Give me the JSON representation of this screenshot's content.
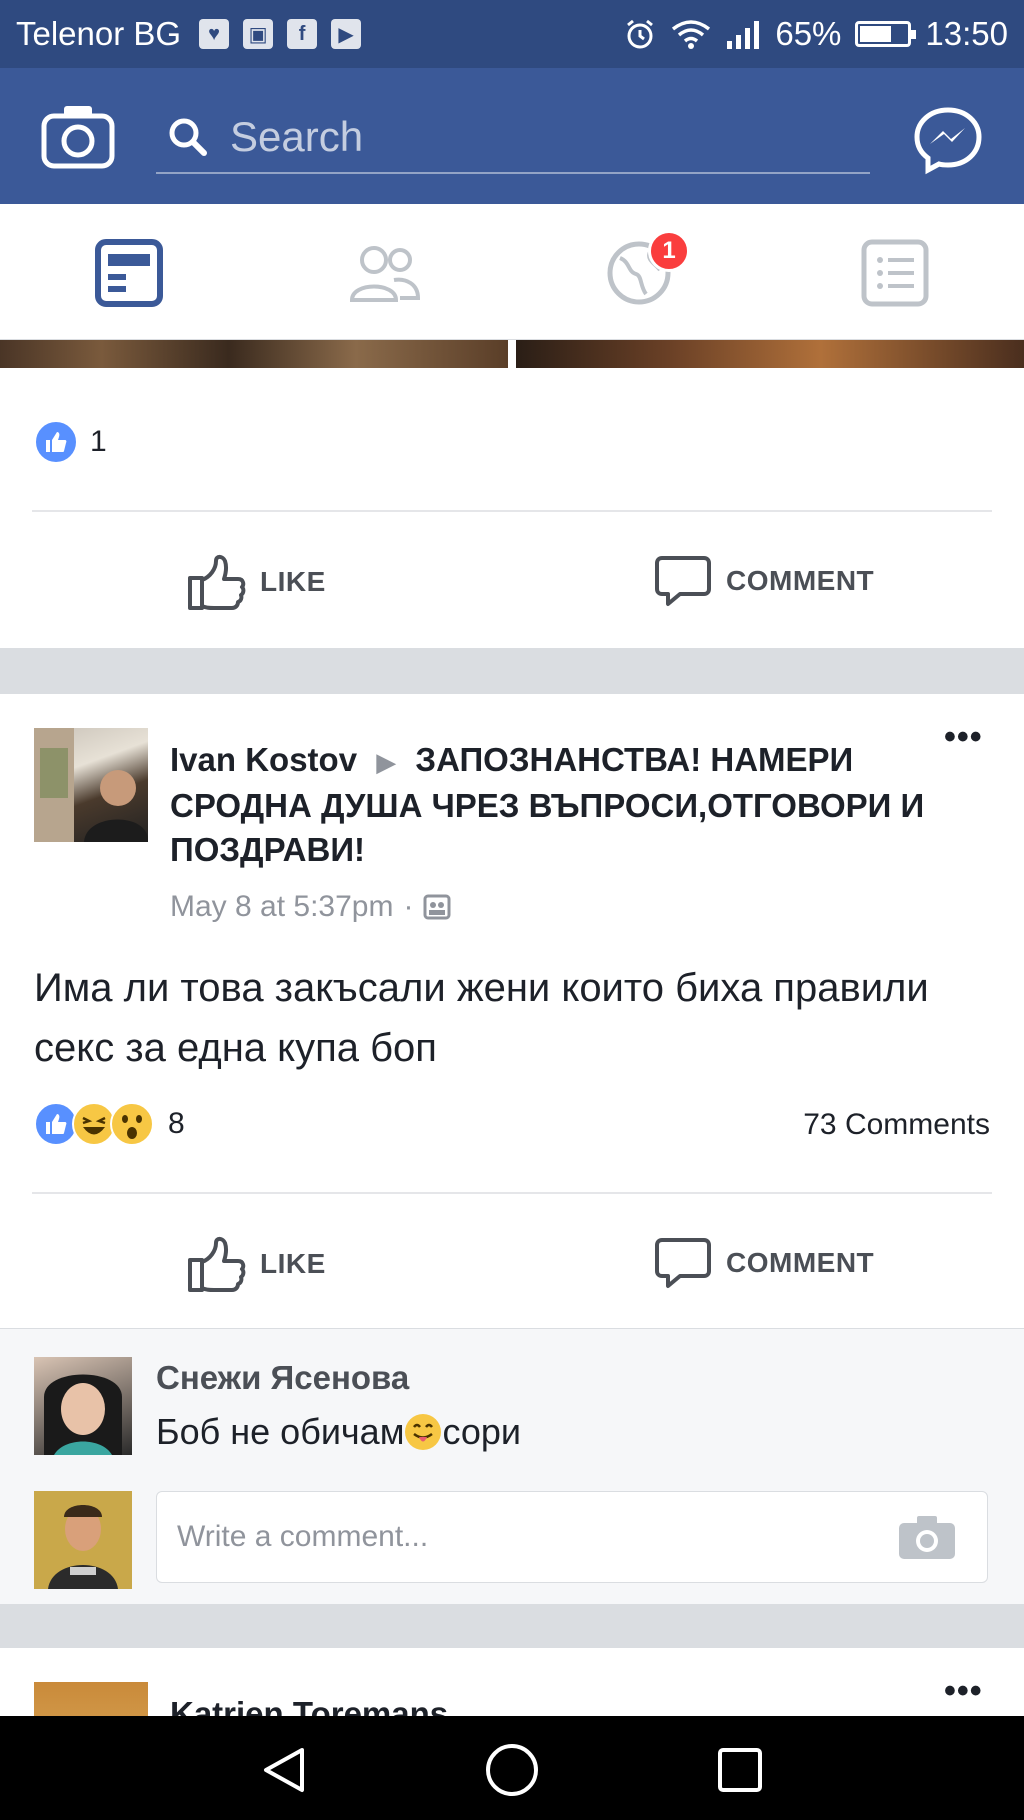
{
  "status_bar": {
    "carrier": "Telenor BG",
    "battery": "65%",
    "time": "13:50"
  },
  "top_bar": {
    "search_placeholder": "Search"
  },
  "notifications": {
    "badge_count": "1"
  },
  "post1": {
    "likes_count": "1",
    "like_label": "LIKE",
    "comment_label": "COMMENT"
  },
  "post2": {
    "author": "Ivan Kostov",
    "group_title": "ЗАПОЗНАНСТВА! НАМЕРИ СРОДНА ДУША ЧРЕЗ ВЪПРОСИ,ОТГОВОРИ И ПОЗДРАВИ!",
    "timestamp": "May 8 at 5:37pm",
    "text": "Има ли това закъсали жени които биха правили секс за една купа боп",
    "reactions_count": "8",
    "comments_count": "73 Comments",
    "like_label": "LIKE",
    "comment_label": "COMMENT",
    "top_comment": {
      "author": "Снежи Ясенова",
      "text_before": "Боб не обичам",
      "text_after": "сори"
    },
    "comment_placeholder": "Write a comment..."
  },
  "post3": {
    "author": "Katrien Toremans"
  },
  "icons": {
    "camera": "camera-icon",
    "search": "search-icon",
    "messenger": "messenger-icon",
    "news_feed": "news-feed-icon",
    "friends": "friends-icon",
    "notifications": "globe-icon",
    "menu": "menu-icon"
  },
  "colors": {
    "brand": "#3b5998",
    "status_bar": "#2f4a80",
    "like_blue": "#5890ff",
    "badge_red": "#fa3e3e"
  }
}
